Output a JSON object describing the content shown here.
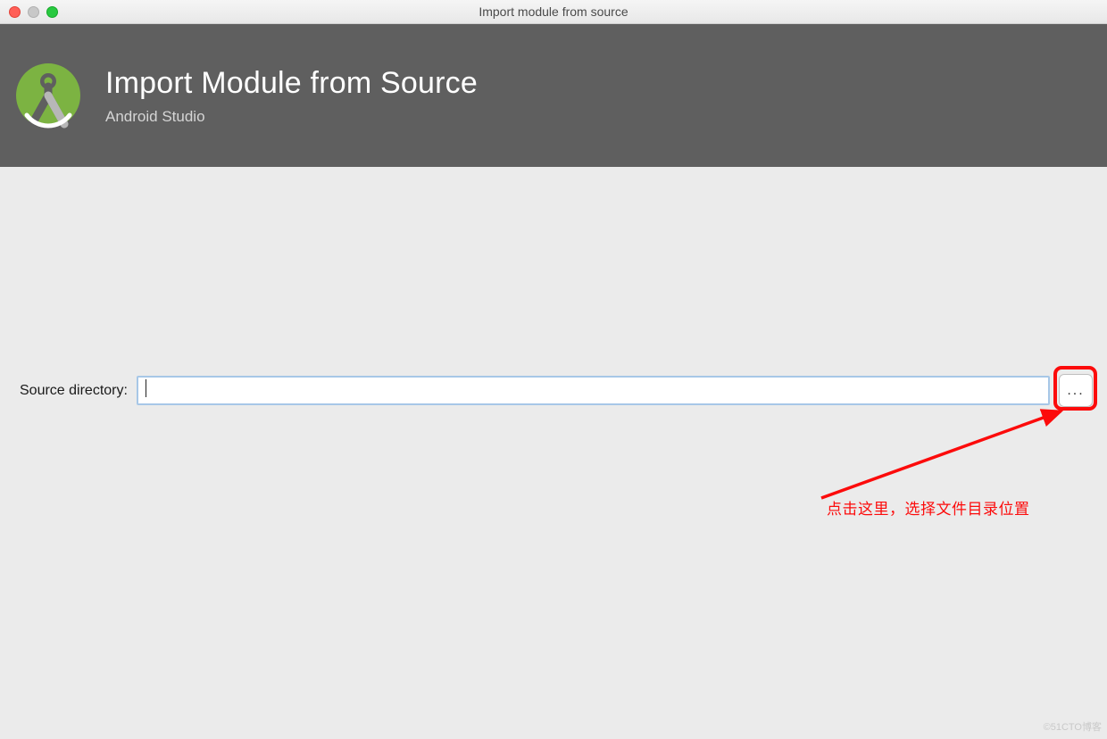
{
  "window": {
    "title": "Import module from source"
  },
  "header": {
    "title": "Import Module from Source",
    "subtitle": "Android Studio"
  },
  "form": {
    "source_directory_label": "Source directory:",
    "source_directory_value": "",
    "browse_label": "..."
  },
  "annotation": {
    "text": "点击这里，选择文件目录位置"
  },
  "watermark": "©51CTO博客",
  "icons": {
    "logo": "android-studio-icon",
    "close": "close-icon",
    "minimize": "minimize-icon",
    "zoom": "zoom-icon",
    "browse": "ellipsis-icon"
  },
  "colors": {
    "banner": "#5f5f5f",
    "accent_green": "#7cb342",
    "focus_border": "#a7c7e7",
    "annotation_red": "#fc0b0b"
  }
}
